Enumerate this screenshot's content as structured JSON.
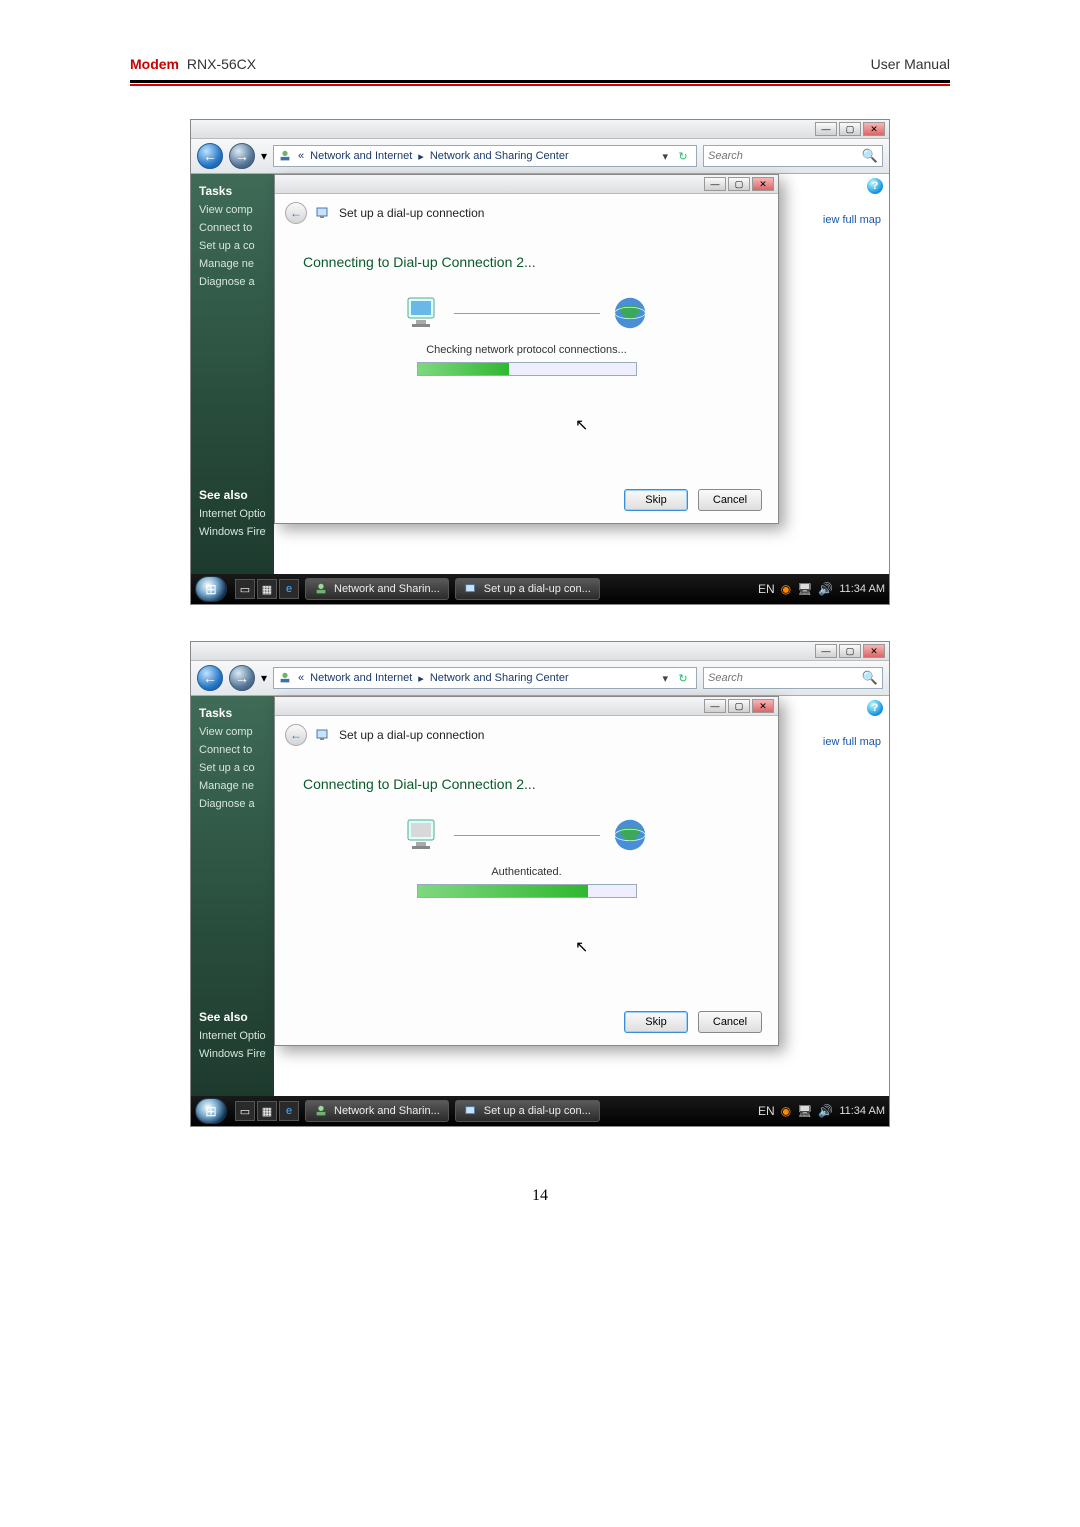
{
  "doc": {
    "brand": "Modem",
    "model": "RNX-56CX",
    "manual_label": "User Manual",
    "page_number": "14"
  },
  "shot1": {
    "breadcrumb_prefix": "«",
    "breadcrumb_1": "Network and Internet",
    "breadcrumb_sep": "▸",
    "breadcrumb_2": "Network and Sharing Center",
    "search_placeholder": "Search",
    "sidebar": {
      "header": "Tasks",
      "items": [
        "View comp",
        "Connect to",
        "Set up a co",
        "Manage ne",
        "Diagnose a"
      ],
      "see_also_header": "See also",
      "see_also_items": [
        "Internet Options",
        "Windows Firewall"
      ]
    },
    "view_full_map": "iew full map",
    "dialog": {
      "title": "Set up a dial-up connection",
      "heading": "Connecting to Dial-up Connection 2...",
      "status": "Checking network protocol connections...",
      "skip": "Skip",
      "cancel": "Cancel"
    },
    "taskbar": {
      "btn1": "Network and Sharin...",
      "btn2": "Set up a dial-up con...",
      "time": "11:34 AM"
    }
  },
  "shot2": {
    "breadcrumb_prefix": "«",
    "breadcrumb_1": "Network and Internet",
    "breadcrumb_sep": "▸",
    "breadcrumb_2": "Network and Sharing Center",
    "search_placeholder": "Search",
    "sidebar": {
      "header": "Tasks",
      "items": [
        "View comp",
        "Connect to",
        "Set up a co",
        "Manage ne",
        "Diagnose a"
      ],
      "see_also_header": "See also",
      "see_also_items": [
        "Internet Options",
        "Windows Firewall"
      ]
    },
    "view_full_map": "iew full map",
    "dialog": {
      "title": "Set up a dial-up connection",
      "heading": "Connecting to Dial-up Connection 2...",
      "status": "Authenticated.",
      "skip": "Skip",
      "cancel": "Cancel"
    },
    "taskbar": {
      "btn1": "Network and Sharin...",
      "btn2": "Set up a dial-up con...",
      "time": "11:34 AM"
    }
  }
}
